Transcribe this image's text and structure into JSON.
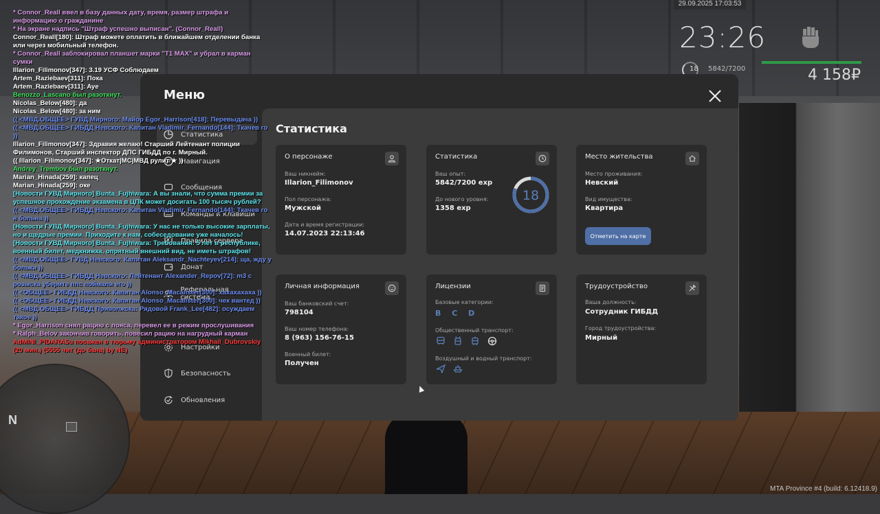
{
  "hud": {
    "datetime": "29.09.2025 17:03:53",
    "clock": "23:26",
    "level": "18",
    "exp": "5842/7200",
    "money": "4 158₽"
  },
  "build": "MTA Province #4 (build: 6.12418.9)",
  "minimap": {
    "north": "N"
  },
  "menu": {
    "title": "Меню",
    "nav": [
      {
        "label": "Статистика",
        "icon": "chart-icon"
      },
      {
        "label": "Навигация",
        "icon": "compass-icon"
      },
      {
        "label": "Сообщения",
        "icon": "message-icon"
      },
      {
        "label": "Команды и клавиши",
        "icon": "keyboard-icon"
      },
      {
        "label": "Правила сервера",
        "icon": "book-icon"
      },
      {
        "label": "Донат",
        "icon": "wallet-icon"
      },
      {
        "label": "Реферальная система",
        "icon": "people-icon"
      },
      {
        "label": "Настройки",
        "icon": "gear-icon"
      },
      {
        "label": "Безопасность",
        "icon": "shield-icon"
      },
      {
        "label": "Обновления",
        "icon": "refresh-icon"
      }
    ]
  },
  "stats": {
    "title": "Статистика",
    "character": {
      "title": "О персонаже",
      "nick_label": "Ваш никнейм:",
      "nick": "Illarion_Filimonov",
      "gender_label": "Пол персонажа:",
      "gender": "Мужской",
      "reg_label": "Дата и время регистрации:",
      "reg": "14.07.2023 22:13:46"
    },
    "statistics": {
      "title": "Статистика",
      "exp_label": "Ваш опыт:",
      "exp": "5842/7200 exp",
      "next_label": "До нового уровня:",
      "next": "1358 exp",
      "level": "18",
      "progress": 0.811
    },
    "residence": {
      "title": "Место жительства",
      "place_label": "Место проживания:",
      "place": "Невский",
      "property_label": "Вид имущества:",
      "property": "Квартира",
      "button": "Отметить на карте"
    },
    "personal": {
      "title": "Личная информация",
      "bank_label": "Ваш банковский счет:",
      "bank": "798104",
      "phone_label": "Ваш номер телефона:",
      "phone": "8 (963) 156-76-15",
      "military_label": "Военный билет:",
      "military": "Получен"
    },
    "licenses": {
      "title": "Лицензии",
      "base_label": "Базовые категории:",
      "base": "B C D",
      "public_label": "Общественный транспорт:",
      "air_label": "Воздушный и водный транспорт:"
    },
    "job": {
      "title": "Трудоустройство",
      "position_label": "Ваша должность:",
      "position": "Сотрудник ГИБДД",
      "city_label": "Город трудоустройства:",
      "city": "Мирный"
    }
  },
  "chat": [
    {
      "text": "* Connor_Reall ввел в базу данных дату, время, размер штрафа и информацию о гражданине",
      "color": "#d99be8"
    },
    {
      "text": "* На экране надпись \"Штраф успешно выписан\". (Connor_Reall)",
      "color": "#d99be8"
    },
    {
      "text": "Connor_Reall[180]: Штраф можете оплатить в ближайшем отделении банка или через мобильный телефон.",
      "color": "#ffffff"
    },
    {
      "text": "* Connor_Reall заблокировал планшет марки \"T1 MAX\" и убрал в карман сумки",
      "color": "#d99be8"
    },
    {
      "text": "Illarion_Filimonov[347]: 3.19 УСФ Соблюдаем",
      "color": "#ffffff"
    },
    {
      "text": "Artem_Raziebaev[311]: Пока",
      "color": "#ffffff"
    },
    {
      "text": "Artem_Raziebaev[311]: Aye",
      "color": "#ffffff"
    },
    {
      "text": "Benozzo_Lascano был разоткнут.",
      "color": "#3fe05a"
    },
    {
      "text": "Nicolas_Below[480]: да",
      "color": "#ffffff"
    },
    {
      "text": "Nicolas_Below[480]: за ним",
      "color": "#ffffff"
    },
    {
      "text": "(( <МВД.ОБЩЕЕ> ГУВД Мирного: Майор Egor_Harrison[418]: Перевыдача ))",
      "color": "#6b8cf2"
    },
    {
      "text": "(( <МВД.ОБЩЕЕ> ГИБДД Невского: Капитан Vladimir_Fernando[144]: Ткачев го ))",
      "color": "#6b8cf2"
    },
    {
      "text": "Illarion_Filimonov[347]: Здравия желаю! Старший Лейтенант полиции Филимонов, Старший инспектор ДПС ГИБДД по г. Мирный.",
      "color": "#ffffff"
    },
    {
      "text": "(( Illarion_Filimonov[347]: ★Откат|МС|МВД рулит ★ ))",
      "color": "#ffffff"
    },
    {
      "text": "Andrey_Trembov был разоткнут.",
      "color": "#3fe05a"
    },
    {
      "text": "Marian_Hinada[259]: капец",
      "color": "#ffffff"
    },
    {
      "text": "Marian_Hinada[259]: оке",
      "color": "#ffffff"
    },
    {
      "text": "[Новости ГУВД Мирного] Bunta_Fujhiwara: А вы знали, что сумма премии за успешное прохождение экзамена в ЦПК может досигать 100 тысяч рублей?",
      "color": "#5ee6ee"
    },
    {
      "text": "(( <МВД.ОБЩЕЕ> ГИБДД Невского: Капитан Vladimir_Fernando[144]: Ткачев го я больна ))",
      "color": "#6b8cf2"
    },
    {
      "text": "[Новости ГУВД Мирного] Bunta_Fujhiwara: У нас не только высокие зарплаты, но и щедрые премии. Приходите к нам, собеседование уже началось!",
      "color": "#5ee6ee"
    },
    {
      "text": "[Новости ГУВД Мирного] Bunta_Fujhiwara: Требования: 5 лет в республике, военный билет, медкнижка, опрятный внешний вид, не иметь штрафов!",
      "color": "#5ee6ee"
    },
    {
      "text": "(( <МВД.ОБЩЕЕ> ГУВД Невского: Капитан Aleksandr_Nachteyev[214]: ща, жду у больки ))",
      "color": "#6b8cf2"
    },
    {
      "text": "(( <МВД.ОБЩЕЕ> ГИБДД Невского: Лейтенант Alexander_Repov[72]: m3 с розыска уберите плс поймали его ))",
      "color": "#6b8cf2"
    },
    {
      "text": "(( <ОБЩЕЕ> ГИБДД Невского: Капитан Alonso_Macalister[300]: хахахахаха ))",
      "color": "#6b8cf2"
    },
    {
      "text": "(( <ОБЩЕЕ> ГИБДД Невского: Капитан Alonso_Macalister[300]: чек вантед ))",
      "color": "#6b8cf2"
    },
    {
      "text": "(( <МВД.ОБЩЕЕ> ГИБДД Приволжска: Рядовой Frank_Lee[482]: осуждаем такое ))",
      "color": "#6b8cf2"
    },
    {
      "text": "* Egor_Harrison снял рацию с пояса, перевел ее в режим прослушивания",
      "color": "#d99be8"
    },
    {
      "text": "* Ralph_Belov закончив говорить, повесил рацию на нагрудный карман",
      "color": "#d99be8"
    },
    {
      "text": "AdMINI_PIDARASu посажен в тюрьму администратором Mikhail_Dubrovskiy (20 мин.) (5555 чит (до бана) by NE)",
      "color": "#ff3a3a"
    }
  ],
  "colors": {
    "accent": "#4f6fa6",
    "panel": "#2a2a2a",
    "card": "#2b2b2b"
  }
}
